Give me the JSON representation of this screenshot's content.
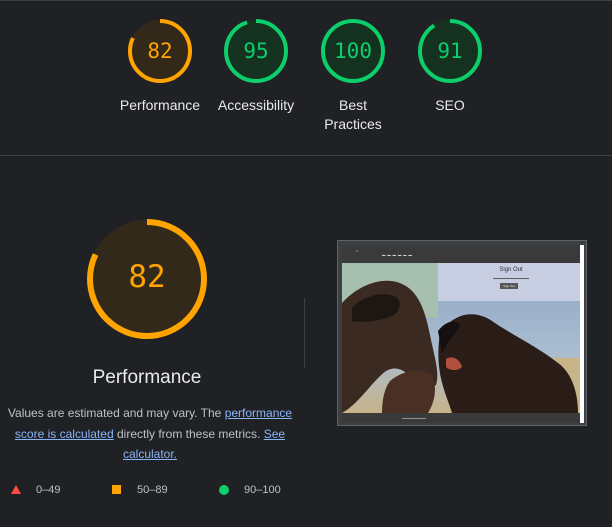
{
  "colors": {
    "background": "#202124",
    "pass": "#0cce6b",
    "average": "#ffa400",
    "fail": "#ff4e42",
    "link": "#8ab4f8"
  },
  "summary": [
    {
      "score": "82",
      "label": "Performance",
      "rating": "average",
      "fraction": 0.82
    },
    {
      "score": "95",
      "label": "Accessibility",
      "rating": "pass",
      "fraction": 0.95
    },
    {
      "score": "100",
      "label": "Best Practices",
      "rating": "pass",
      "fraction": 1.0
    },
    {
      "score": "91",
      "label": "SEO",
      "rating": "pass",
      "fraction": 0.91
    }
  ],
  "performance": {
    "score": "82",
    "fraction": 0.82,
    "title": "Performance",
    "desc_prefix": "Values are estimated and may vary. The",
    "desc_link": "performance score is calculated",
    "desc_middle": "directly from these metrics.",
    "calculator_link": "See calculator."
  },
  "legend": [
    {
      "symbol": "triangle-icon",
      "range": "0–49"
    },
    {
      "symbol": "square-icon",
      "range": "50–89"
    },
    {
      "symbol": "circle-icon",
      "range": "90–100"
    }
  ],
  "screenshot": {
    "signout_title": "Sign Out",
    "signout_button": "Sign Out"
  }
}
